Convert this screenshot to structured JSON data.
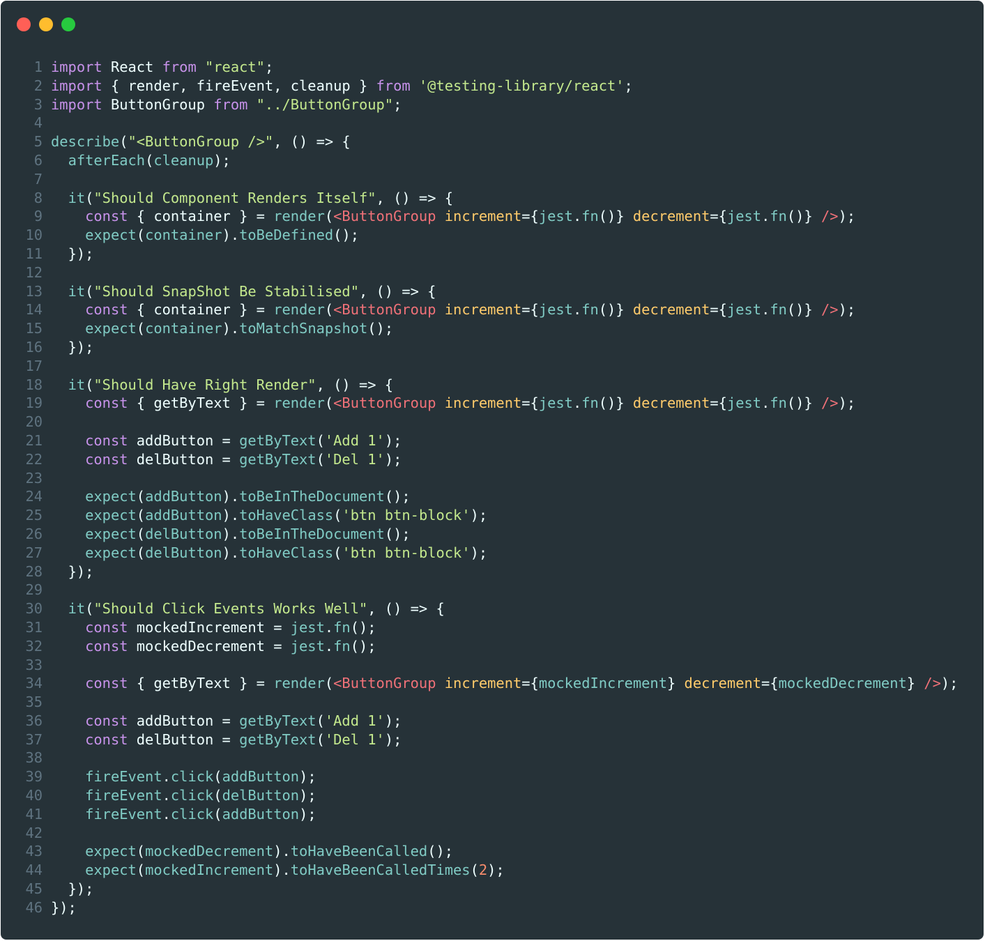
{
  "colors": {
    "background": "#263238",
    "line_number": "#5f7380",
    "traffic_red": "#ff5f56",
    "traffic_yellow": "#ffbd2e",
    "traffic_green": "#27c93f"
  },
  "window_controls": [
    {
      "name": "close-button",
      "color": "#ff5f56"
    },
    {
      "name": "minimize-button",
      "color": "#ffbd2e"
    },
    {
      "name": "maximize-button",
      "color": "#27c93f"
    }
  ],
  "code": {
    "language": "javascript",
    "lines": [
      [
        [
          "kw",
          "import"
        ],
        [
          "id",
          " React "
        ],
        [
          "kw",
          "from"
        ],
        [
          "id",
          " "
        ],
        [
          "str",
          "\"react\""
        ],
        [
          "punc",
          ";"
        ]
      ],
      [
        [
          "kw",
          "import"
        ],
        [
          "id",
          " { render, fireEvent, cleanup } "
        ],
        [
          "kw",
          "from"
        ],
        [
          "id",
          " "
        ],
        [
          "str",
          "'@testing-library/react'"
        ],
        [
          "punc",
          ";"
        ]
      ],
      [
        [
          "kw",
          "import"
        ],
        [
          "id",
          " ButtonGroup "
        ],
        [
          "kw",
          "from"
        ],
        [
          "id",
          " "
        ],
        [
          "str",
          "\"../ButtonGroup\""
        ],
        [
          "punc",
          ";"
        ]
      ],
      [],
      [
        [
          "fn",
          "describe"
        ],
        [
          "punc",
          "("
        ],
        [
          "str",
          "\"<ButtonGroup />\""
        ],
        [
          "punc",
          ", () => {"
        ]
      ],
      [
        [
          "id",
          "  "
        ],
        [
          "fn",
          "afterEach"
        ],
        [
          "punc",
          "("
        ],
        [
          "fn",
          "cleanup"
        ],
        [
          "punc",
          ");"
        ]
      ],
      [],
      [
        [
          "id",
          "  "
        ],
        [
          "fn",
          "it"
        ],
        [
          "punc",
          "("
        ],
        [
          "str",
          "\"Should Component Renders Itself\""
        ],
        [
          "punc",
          ", () => {"
        ]
      ],
      [
        [
          "id",
          "    "
        ],
        [
          "kw",
          "const"
        ],
        [
          "id",
          " { container } = "
        ],
        [
          "fn",
          "render"
        ],
        [
          "punc",
          "("
        ],
        [
          "tag",
          "<ButtonGroup"
        ],
        [
          "id",
          " "
        ],
        [
          "attr",
          "increment"
        ],
        [
          "punc",
          "={"
        ],
        [
          "fn",
          "jest"
        ],
        [
          "punc",
          "."
        ],
        [
          "fn",
          "fn"
        ],
        [
          "punc",
          "()} "
        ],
        [
          "attr",
          "decrement"
        ],
        [
          "punc",
          "={"
        ],
        [
          "fn",
          "jest"
        ],
        [
          "punc",
          "."
        ],
        [
          "fn",
          "fn"
        ],
        [
          "punc",
          "()} "
        ],
        [
          "tag",
          "/>"
        ],
        [
          "punc",
          ");"
        ]
      ],
      [
        [
          "id",
          "    "
        ],
        [
          "fn",
          "expect"
        ],
        [
          "punc",
          "("
        ],
        [
          "fn",
          "container"
        ],
        [
          "punc",
          ")."
        ],
        [
          "fn",
          "toBeDefined"
        ],
        [
          "punc",
          "();"
        ]
      ],
      [
        [
          "id",
          "  "
        ],
        [
          "punc",
          "});"
        ]
      ],
      [],
      [
        [
          "id",
          "  "
        ],
        [
          "fn",
          "it"
        ],
        [
          "punc",
          "("
        ],
        [
          "str",
          "\"Should SnapShot Be Stabilised\""
        ],
        [
          "punc",
          ", () => {"
        ]
      ],
      [
        [
          "id",
          "    "
        ],
        [
          "kw",
          "const"
        ],
        [
          "id",
          " { container } = "
        ],
        [
          "fn",
          "render"
        ],
        [
          "punc",
          "("
        ],
        [
          "tag",
          "<ButtonGroup"
        ],
        [
          "id",
          " "
        ],
        [
          "attr",
          "increment"
        ],
        [
          "punc",
          "={"
        ],
        [
          "fn",
          "jest"
        ],
        [
          "punc",
          "."
        ],
        [
          "fn",
          "fn"
        ],
        [
          "punc",
          "()} "
        ],
        [
          "attr",
          "decrement"
        ],
        [
          "punc",
          "={"
        ],
        [
          "fn",
          "jest"
        ],
        [
          "punc",
          "."
        ],
        [
          "fn",
          "fn"
        ],
        [
          "punc",
          "()} "
        ],
        [
          "tag",
          "/>"
        ],
        [
          "punc",
          ");"
        ]
      ],
      [
        [
          "id",
          "    "
        ],
        [
          "fn",
          "expect"
        ],
        [
          "punc",
          "("
        ],
        [
          "fn",
          "container"
        ],
        [
          "punc",
          ")."
        ],
        [
          "fn",
          "toMatchSnapshot"
        ],
        [
          "punc",
          "();"
        ]
      ],
      [
        [
          "id",
          "  "
        ],
        [
          "punc",
          "});"
        ]
      ],
      [],
      [
        [
          "id",
          "  "
        ],
        [
          "fn",
          "it"
        ],
        [
          "punc",
          "("
        ],
        [
          "str",
          "\"Should Have Right Render\""
        ],
        [
          "punc",
          ", () => {"
        ]
      ],
      [
        [
          "id",
          "    "
        ],
        [
          "kw",
          "const"
        ],
        [
          "id",
          " { getByText } = "
        ],
        [
          "fn",
          "render"
        ],
        [
          "punc",
          "("
        ],
        [
          "tag",
          "<ButtonGroup"
        ],
        [
          "id",
          " "
        ],
        [
          "attr",
          "increment"
        ],
        [
          "punc",
          "={"
        ],
        [
          "fn",
          "jest"
        ],
        [
          "punc",
          "."
        ],
        [
          "fn",
          "fn"
        ],
        [
          "punc",
          "()} "
        ],
        [
          "attr",
          "decrement"
        ],
        [
          "punc",
          "={"
        ],
        [
          "fn",
          "jest"
        ],
        [
          "punc",
          "."
        ],
        [
          "fn",
          "fn"
        ],
        [
          "punc",
          "()} "
        ],
        [
          "tag",
          "/>"
        ],
        [
          "punc",
          ");"
        ]
      ],
      [],
      [
        [
          "id",
          "    "
        ],
        [
          "kw",
          "const"
        ],
        [
          "id",
          " addButton = "
        ],
        [
          "fn",
          "getByText"
        ],
        [
          "punc",
          "("
        ],
        [
          "str",
          "'Add 1'"
        ],
        [
          "punc",
          ");"
        ]
      ],
      [
        [
          "id",
          "    "
        ],
        [
          "kw",
          "const"
        ],
        [
          "id",
          " delButton = "
        ],
        [
          "fn",
          "getByText"
        ],
        [
          "punc",
          "("
        ],
        [
          "str",
          "'Del 1'"
        ],
        [
          "punc",
          ");"
        ]
      ],
      [],
      [
        [
          "id",
          "    "
        ],
        [
          "fn",
          "expect"
        ],
        [
          "punc",
          "("
        ],
        [
          "fn",
          "addButton"
        ],
        [
          "punc",
          ")."
        ],
        [
          "fn",
          "toBeInTheDocument"
        ],
        [
          "punc",
          "();"
        ]
      ],
      [
        [
          "id",
          "    "
        ],
        [
          "fn",
          "expect"
        ],
        [
          "punc",
          "("
        ],
        [
          "fn",
          "addButton"
        ],
        [
          "punc",
          ")."
        ],
        [
          "fn",
          "toHaveClass"
        ],
        [
          "punc",
          "("
        ],
        [
          "str",
          "'btn btn-block'"
        ],
        [
          "punc",
          ");"
        ]
      ],
      [
        [
          "id",
          "    "
        ],
        [
          "fn",
          "expect"
        ],
        [
          "punc",
          "("
        ],
        [
          "fn",
          "delButton"
        ],
        [
          "punc",
          ")."
        ],
        [
          "fn",
          "toBeInTheDocument"
        ],
        [
          "punc",
          "();"
        ]
      ],
      [
        [
          "id",
          "    "
        ],
        [
          "fn",
          "expect"
        ],
        [
          "punc",
          "("
        ],
        [
          "fn",
          "delButton"
        ],
        [
          "punc",
          ")."
        ],
        [
          "fn",
          "toHaveClass"
        ],
        [
          "punc",
          "("
        ],
        [
          "str",
          "'btn btn-block'"
        ],
        [
          "punc",
          ");"
        ]
      ],
      [
        [
          "id",
          "  "
        ],
        [
          "punc",
          "});"
        ]
      ],
      [],
      [
        [
          "id",
          "  "
        ],
        [
          "fn",
          "it"
        ],
        [
          "punc",
          "("
        ],
        [
          "str",
          "\"Should Click Events Works Well\""
        ],
        [
          "punc",
          ", () => {"
        ]
      ],
      [
        [
          "id",
          "    "
        ],
        [
          "kw",
          "const"
        ],
        [
          "id",
          " mockedIncrement = "
        ],
        [
          "fn",
          "jest"
        ],
        [
          "punc",
          "."
        ],
        [
          "fn",
          "fn"
        ],
        [
          "punc",
          "();"
        ]
      ],
      [
        [
          "id",
          "    "
        ],
        [
          "kw",
          "const"
        ],
        [
          "id",
          " mockedDecrement = "
        ],
        [
          "fn",
          "jest"
        ],
        [
          "punc",
          "."
        ],
        [
          "fn",
          "fn"
        ],
        [
          "punc",
          "();"
        ]
      ],
      [],
      [
        [
          "id",
          "    "
        ],
        [
          "kw",
          "const"
        ],
        [
          "id",
          " { getByText } = "
        ],
        [
          "fn",
          "render"
        ],
        [
          "punc",
          "("
        ],
        [
          "tag",
          "<ButtonGroup"
        ],
        [
          "id",
          " "
        ],
        [
          "attr",
          "increment"
        ],
        [
          "punc",
          "={"
        ],
        [
          "fn",
          "mockedIncrement"
        ],
        [
          "punc",
          "} "
        ],
        [
          "attr",
          "decrement"
        ],
        [
          "punc",
          "={"
        ],
        [
          "fn",
          "mockedDecrement"
        ],
        [
          "punc",
          "} "
        ],
        [
          "tag",
          "/>"
        ],
        [
          "punc",
          ");"
        ]
      ],
      [],
      [
        [
          "id",
          "    "
        ],
        [
          "kw",
          "const"
        ],
        [
          "id",
          " addButton = "
        ],
        [
          "fn",
          "getByText"
        ],
        [
          "punc",
          "("
        ],
        [
          "str",
          "'Add 1'"
        ],
        [
          "punc",
          ");"
        ]
      ],
      [
        [
          "id",
          "    "
        ],
        [
          "kw",
          "const"
        ],
        [
          "id",
          " delButton = "
        ],
        [
          "fn",
          "getByText"
        ],
        [
          "punc",
          "("
        ],
        [
          "str",
          "'Del 1'"
        ],
        [
          "punc",
          ");"
        ]
      ],
      [],
      [
        [
          "id",
          "    "
        ],
        [
          "fn",
          "fireEvent"
        ],
        [
          "punc",
          "."
        ],
        [
          "fn",
          "click"
        ],
        [
          "punc",
          "("
        ],
        [
          "fn",
          "addButton"
        ],
        [
          "punc",
          ");"
        ]
      ],
      [
        [
          "id",
          "    "
        ],
        [
          "fn",
          "fireEvent"
        ],
        [
          "punc",
          "."
        ],
        [
          "fn",
          "click"
        ],
        [
          "punc",
          "("
        ],
        [
          "fn",
          "delButton"
        ],
        [
          "punc",
          ");"
        ]
      ],
      [
        [
          "id",
          "    "
        ],
        [
          "fn",
          "fireEvent"
        ],
        [
          "punc",
          "."
        ],
        [
          "fn",
          "click"
        ],
        [
          "punc",
          "("
        ],
        [
          "fn",
          "addButton"
        ],
        [
          "punc",
          ");"
        ]
      ],
      [],
      [
        [
          "id",
          "    "
        ],
        [
          "fn",
          "expect"
        ],
        [
          "punc",
          "("
        ],
        [
          "fn",
          "mockedDecrement"
        ],
        [
          "punc",
          ")."
        ],
        [
          "fn",
          "toHaveBeenCalled"
        ],
        [
          "punc",
          "();"
        ]
      ],
      [
        [
          "id",
          "    "
        ],
        [
          "fn",
          "expect"
        ],
        [
          "punc",
          "("
        ],
        [
          "fn",
          "mockedIncrement"
        ],
        [
          "punc",
          ")."
        ],
        [
          "fn",
          "toHaveBeenCalledTimes"
        ],
        [
          "punc",
          "("
        ],
        [
          "num",
          "2"
        ],
        [
          "punc",
          ");"
        ]
      ],
      [
        [
          "id",
          "  "
        ],
        [
          "punc",
          "});"
        ]
      ],
      [
        [
          "punc",
          "});"
        ]
      ]
    ]
  }
}
